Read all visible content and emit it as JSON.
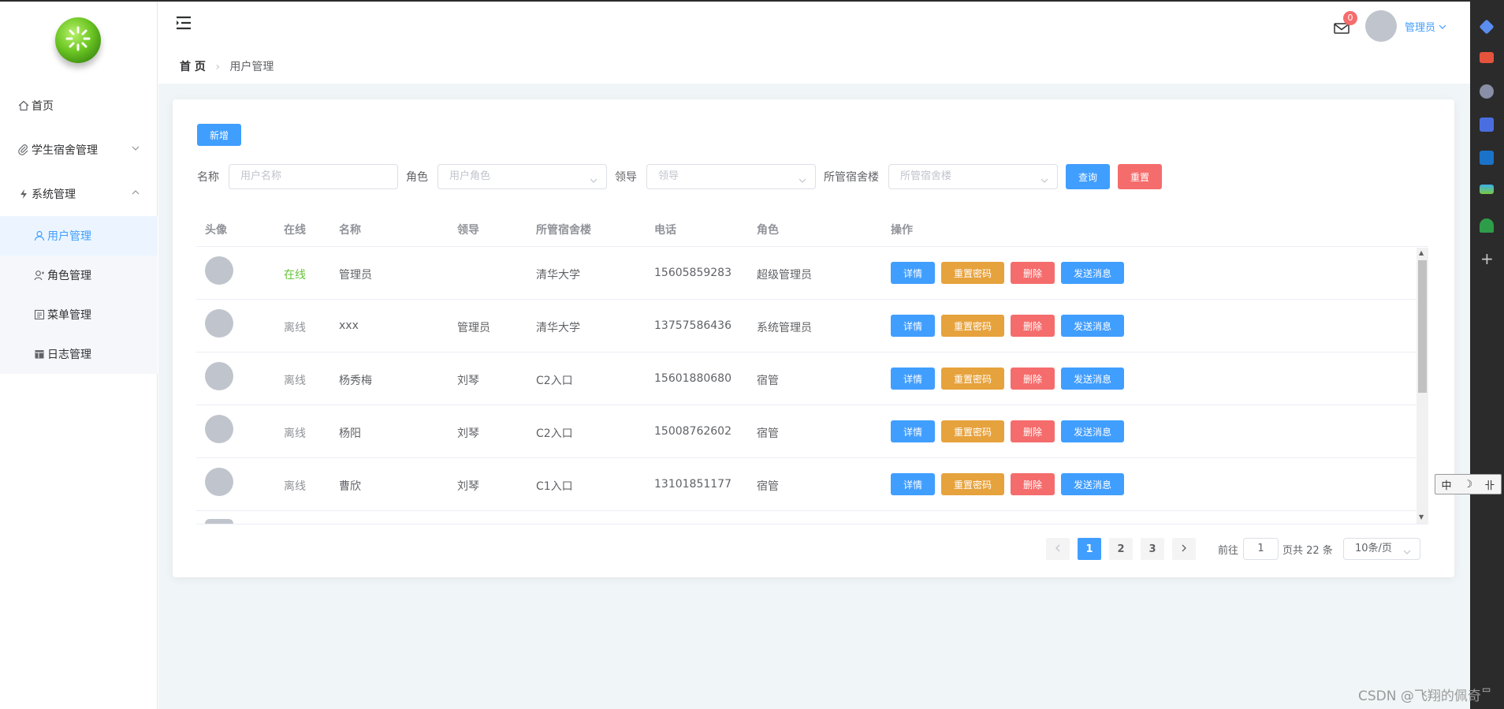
{
  "sidebar": {
    "items": [
      {
        "label": "首页"
      },
      {
        "label": "学生宿舍管理"
      },
      {
        "label": "系统管理"
      },
      {
        "label": "用户管理"
      },
      {
        "label": "角色管理"
      },
      {
        "label": "菜单管理"
      },
      {
        "label": "日志管理"
      }
    ]
  },
  "header": {
    "breadcrumb_home": "首 页",
    "breadcrumb_current": "用户管理",
    "badge_count": "0",
    "user_name": "管理员"
  },
  "toolbar": {
    "add_label": "新增"
  },
  "filters": {
    "name_label": "名称",
    "name_placeholder": "用户名称",
    "role_label": "角色",
    "role_placeholder": "用户角色",
    "leader_label": "领导",
    "leader_placeholder": "领导",
    "building_label": "所管宿舍楼",
    "building_placeholder": "所管宿舍楼",
    "query_label": "查询",
    "reset_label": "重置"
  },
  "table": {
    "headers": [
      "头像",
      "在线",
      "名称",
      "领导",
      "所管宿舍楼",
      "电话",
      "角色",
      "操作"
    ],
    "actions": {
      "detail": "详情",
      "reset_pwd": "重置密码",
      "delete": "删除",
      "send_msg": "发送消息"
    },
    "rows": [
      {
        "online": "在线",
        "name": "管理员",
        "leader": "",
        "building": "清华大学",
        "phone": "15605859283",
        "role": "超级管理员"
      },
      {
        "online": "离线",
        "name": "xxx",
        "leader": "管理员",
        "building": "清华大学",
        "phone": "13757586436",
        "role": "系统管理员"
      },
      {
        "online": "离线",
        "name": "杨秀梅",
        "leader": "刘琴",
        "building": "C2入口",
        "phone": "15601880680",
        "role": "宿管"
      },
      {
        "online": "离线",
        "name": "杨阳",
        "leader": "刘琴",
        "building": "C2入口",
        "phone": "15008762602",
        "role": "宿管"
      },
      {
        "online": "离线",
        "name": "曹欣",
        "leader": "刘琴",
        "building": "C1入口",
        "phone": "13101851177",
        "role": "宿管"
      }
    ]
  },
  "pagination": {
    "pages": [
      "1",
      "2",
      "3"
    ],
    "current": "1",
    "goto_label": "前往",
    "goto_value": "1",
    "total_label": "页共 22 条",
    "page_size": "10条/页"
  },
  "ime": {
    "lang": "中"
  },
  "watermark": "CSDN @飞翔的佩奇",
  "colors": {
    "primary": "#409eff",
    "danger": "#f56c6c",
    "warning": "#e6a23c",
    "success": "#67c23a"
  }
}
